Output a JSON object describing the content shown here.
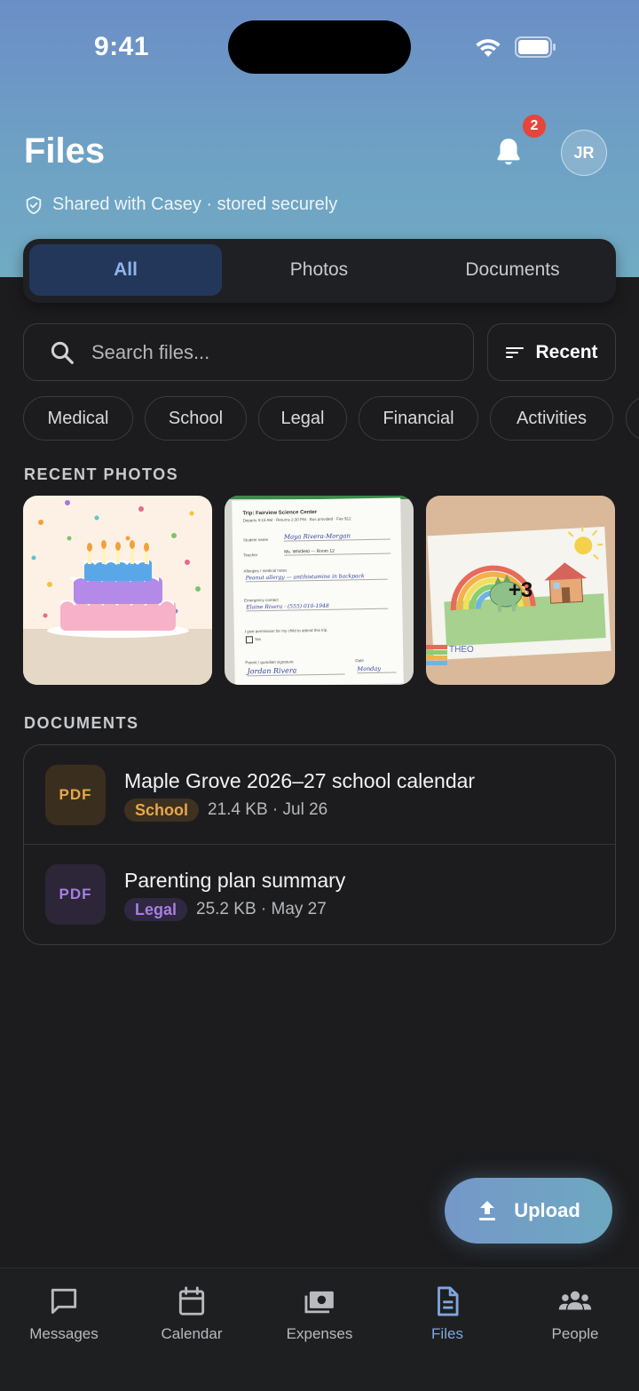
{
  "status": {
    "time": "9:41"
  },
  "header": {
    "title": "Files",
    "notification_count": "2",
    "avatar_initials": "JR",
    "shared_text": "Shared with Casey · stored securely"
  },
  "segments": [
    {
      "label": "All",
      "active": true
    },
    {
      "label": "Photos",
      "active": false
    },
    {
      "label": "Documents",
      "active": false
    }
  ],
  "search": {
    "placeholder": "Search files..."
  },
  "sort": {
    "label": "Recent"
  },
  "chips": [
    "Medical",
    "School",
    "Legal",
    "Financial",
    "Activities"
  ],
  "recent_photos": {
    "label": "RECENT PHOTOS",
    "more_count": "+3",
    "permission_slip": {
      "trip_title": "Trip: Fairview Science Center",
      "trip_details": "Departs 9:15 AM · Returns 2:30 PM · Bus provided · Fee $12",
      "student_label": "Student name",
      "student_value": "Maya Rivera-Morgan",
      "teacher_label": "Teacher",
      "teacher_value": "Ms. Whitfield — Room 12",
      "allergy_label": "Allergies / medical notes",
      "allergy_value": "Peanut allergy — antihistamine in backpack",
      "emergency_label": "Emergency contact",
      "emergency_value": "Elaine Rivera · (555) 010-1948",
      "permission_text": "I give permission for my child to attend this trip.",
      "yes_label": "Yes",
      "signature_label": "Parent / guardian signature",
      "signature_value": "Jordan Rivera",
      "date_label": "Date",
      "date_value": "Monday"
    },
    "drawing_text": "THEO"
  },
  "documents": {
    "label": "DOCUMENTS",
    "items": [
      {
        "type": "PDF",
        "title": "Maple Grove 2026–27 school calendar",
        "tag": "School",
        "meta": "21.4 KB · Jul 26"
      },
      {
        "type": "PDF",
        "title": "Parenting plan summary",
        "tag": "Legal",
        "meta": "25.2 KB · May 27"
      }
    ]
  },
  "upload": {
    "label": "Upload"
  },
  "tabs": [
    {
      "label": "Messages",
      "icon": "message-icon"
    },
    {
      "label": "Calendar",
      "icon": "calendar-icon"
    },
    {
      "label": "Expenses",
      "icon": "cash-icon"
    },
    {
      "label": "Files",
      "icon": "file-icon",
      "active": true
    },
    {
      "label": "People",
      "icon": "people-icon"
    }
  ],
  "colors": {
    "accent": "#7fa7dd",
    "school_tag": "#e8a84a",
    "legal_tag": "#a77fe0",
    "badge": "#e5453c"
  }
}
